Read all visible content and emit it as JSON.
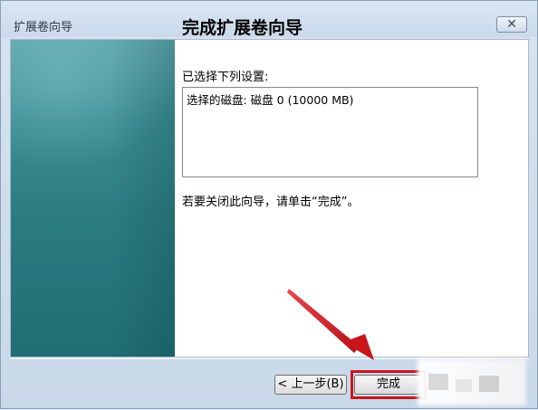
{
  "window": {
    "title": "扩展卷向导",
    "close_glyph": "✕"
  },
  "wizard": {
    "heading": "完成扩展卷向导",
    "settings_label": "已选择下列设置:",
    "settings_list": [
      "选择的磁盘: 磁盘 0 (10000 MB)"
    ],
    "instruction": "若要关闭此向导，请单击“完成”。"
  },
  "buttons": {
    "back": "< 上一步(B)",
    "finish": "完成"
  },
  "annotation": {
    "arrow_color": "#c9161d",
    "highlight_color": "#c9161d"
  }
}
